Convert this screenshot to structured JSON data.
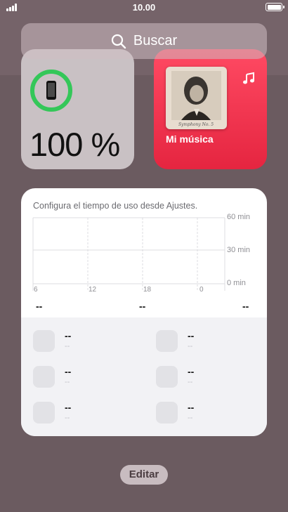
{
  "status_bar": {
    "time": "10.00"
  },
  "search": {
    "placeholder": "Buscar",
    "icon": "search-icon"
  },
  "battery_widget": {
    "percent_text": "100 %",
    "level": 100,
    "icon": "iphone-icon",
    "ring_color": "#34c759"
  },
  "music_widget": {
    "title": "Mi música",
    "album_caption": "Symphony No. 5",
    "icon": "music-note-icon",
    "accent": "#fa2d48"
  },
  "screen_time": {
    "header": "Configura el tiempo de uso desde Ajustes.",
    "y_labels": [
      "60 min",
      "30 min",
      "0 min"
    ],
    "x_labels": [
      "6",
      "12",
      "18",
      "0"
    ],
    "summary_values": [
      "--",
      "--",
      "--"
    ],
    "apps": [
      {
        "name": "--",
        "time": "--"
      },
      {
        "name": "--",
        "time": "--"
      },
      {
        "name": "--",
        "time": "--"
      },
      {
        "name": "--",
        "time": "--"
      },
      {
        "name": "--",
        "time": "--"
      },
      {
        "name": "--",
        "time": "--"
      }
    ]
  },
  "edit_button": {
    "label": "Editar"
  }
}
